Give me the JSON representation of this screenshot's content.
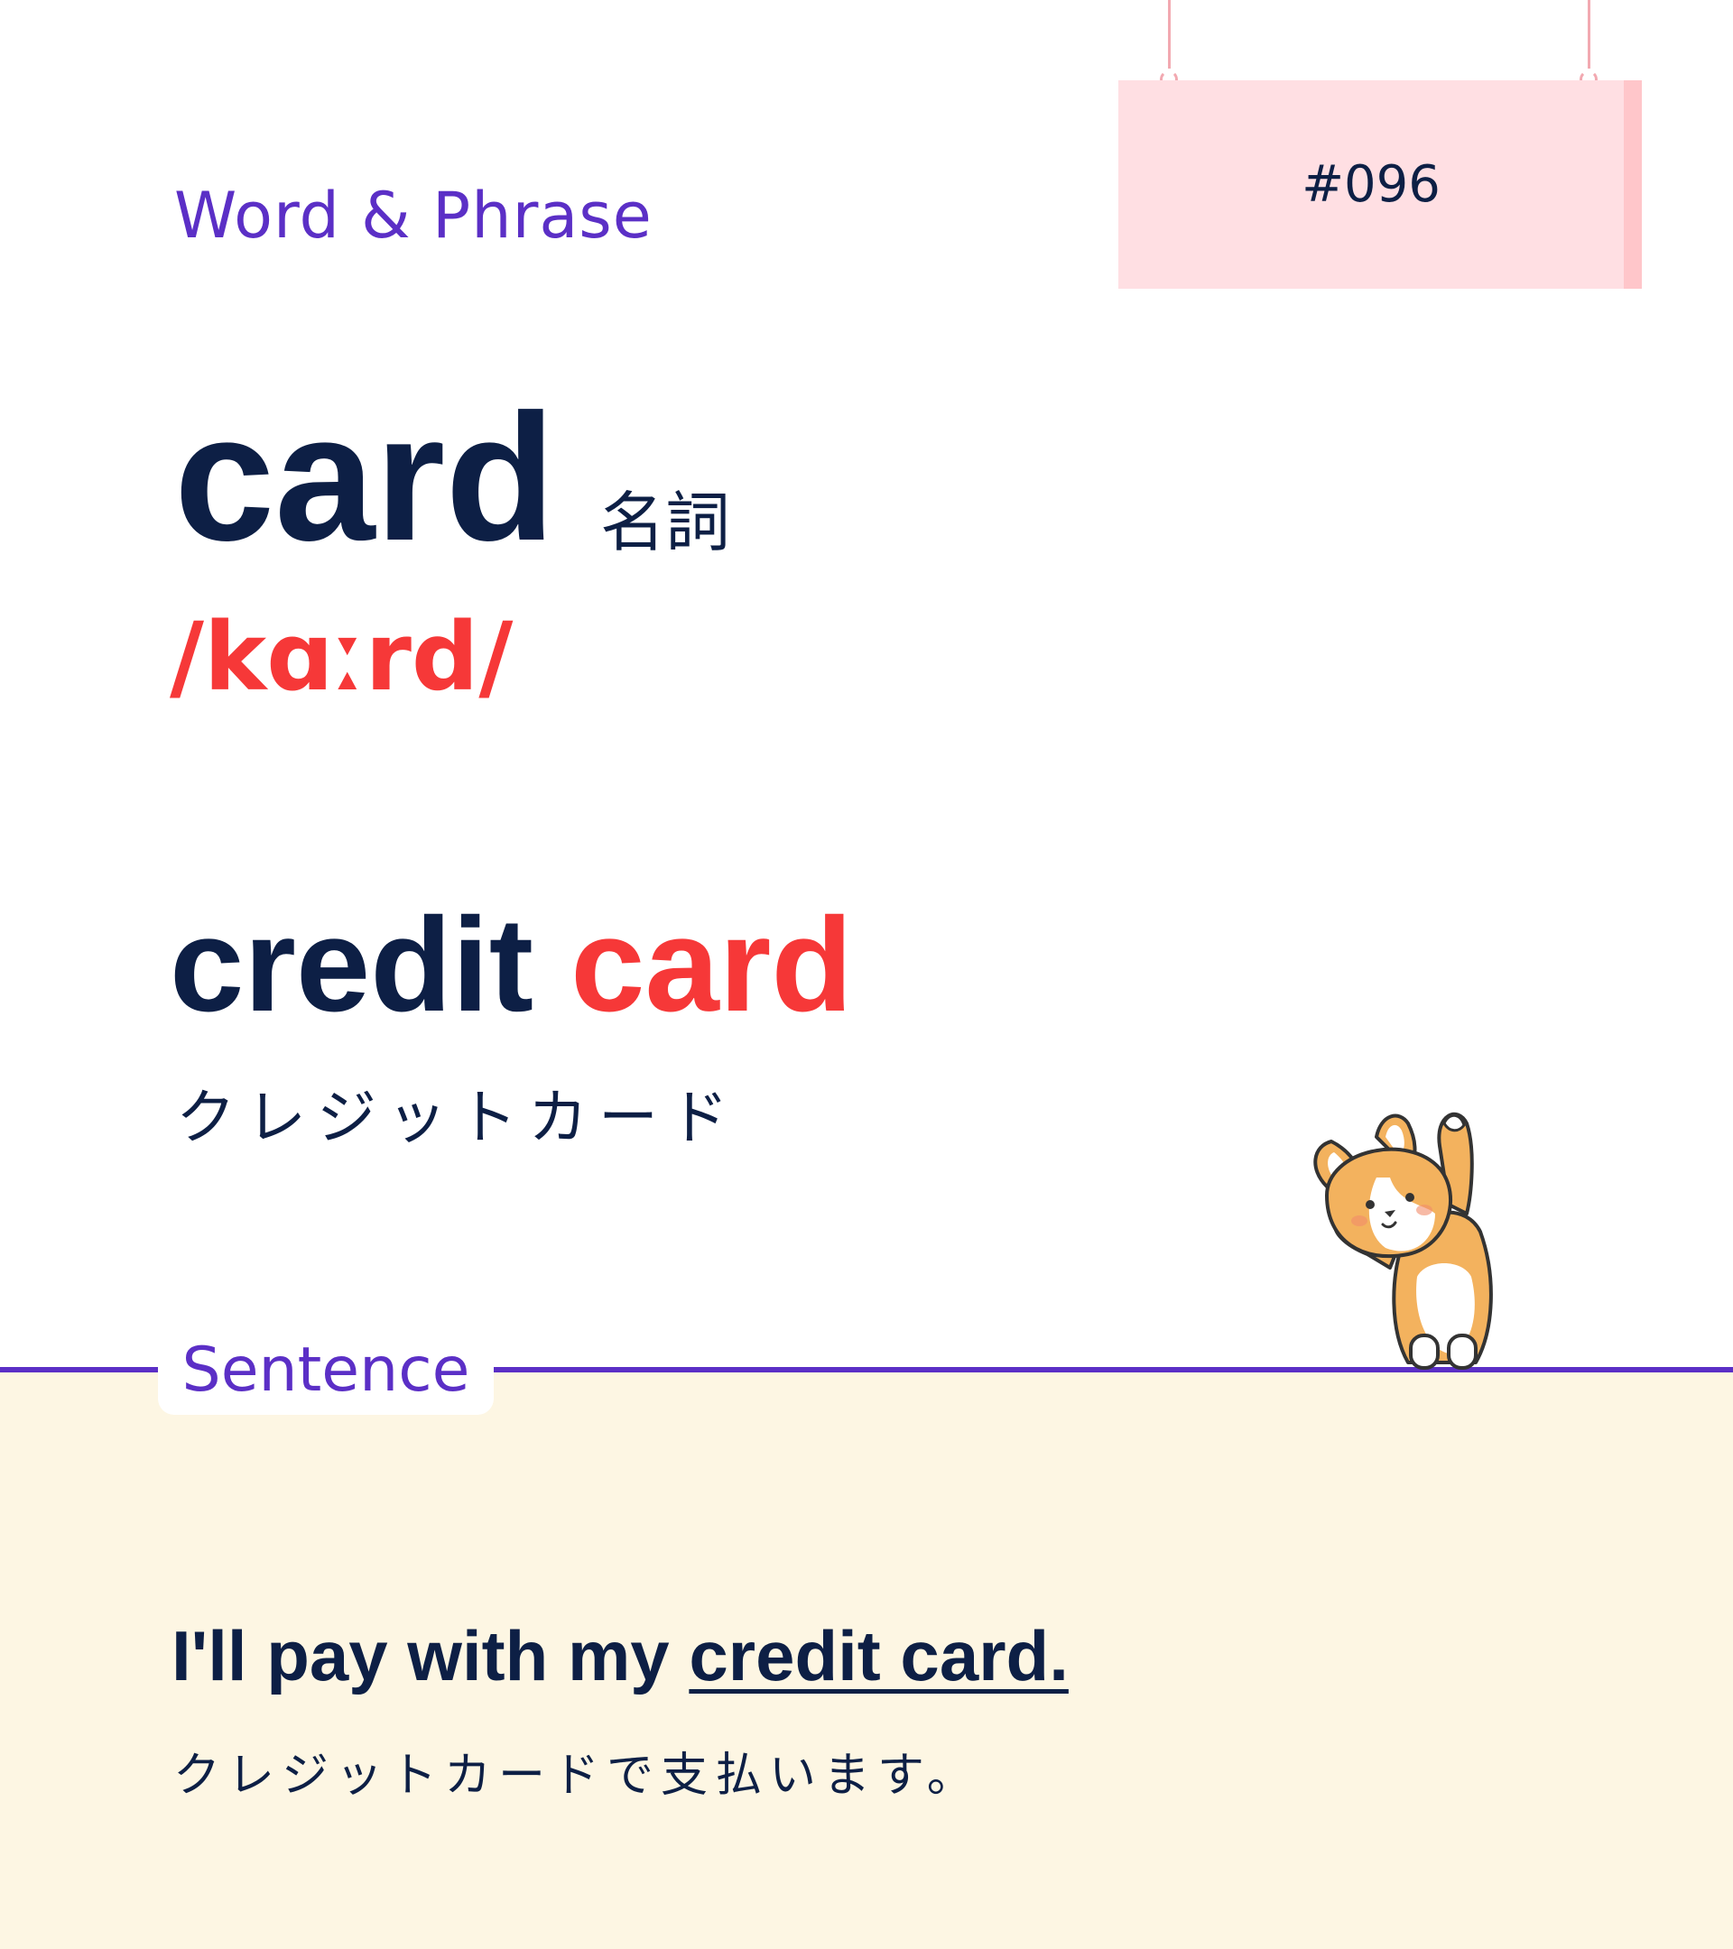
{
  "header": {
    "section_label": "Word & Phrase",
    "number": "#096"
  },
  "word": {
    "headword": "card",
    "part_of_speech": "名詞",
    "pronunciation": "/kɑːrd/"
  },
  "phrase": {
    "prefix": "credit ",
    "highlight": "card",
    "translation": "クレジットカード"
  },
  "sentence": {
    "label": "Sentence",
    "prefix": "I'll pay with my ",
    "underlined": "credit card.",
    "translation": "クレジットカードで支払います。"
  },
  "colors": {
    "accent_purple": "#5b2fc6",
    "highlight_red": "#f63838",
    "text_navy": "#0d1f45",
    "sign_pink": "#ffdfe3",
    "sentence_bg": "#fdf6e3"
  },
  "icons": {
    "mascot": "corgi-illustration"
  }
}
